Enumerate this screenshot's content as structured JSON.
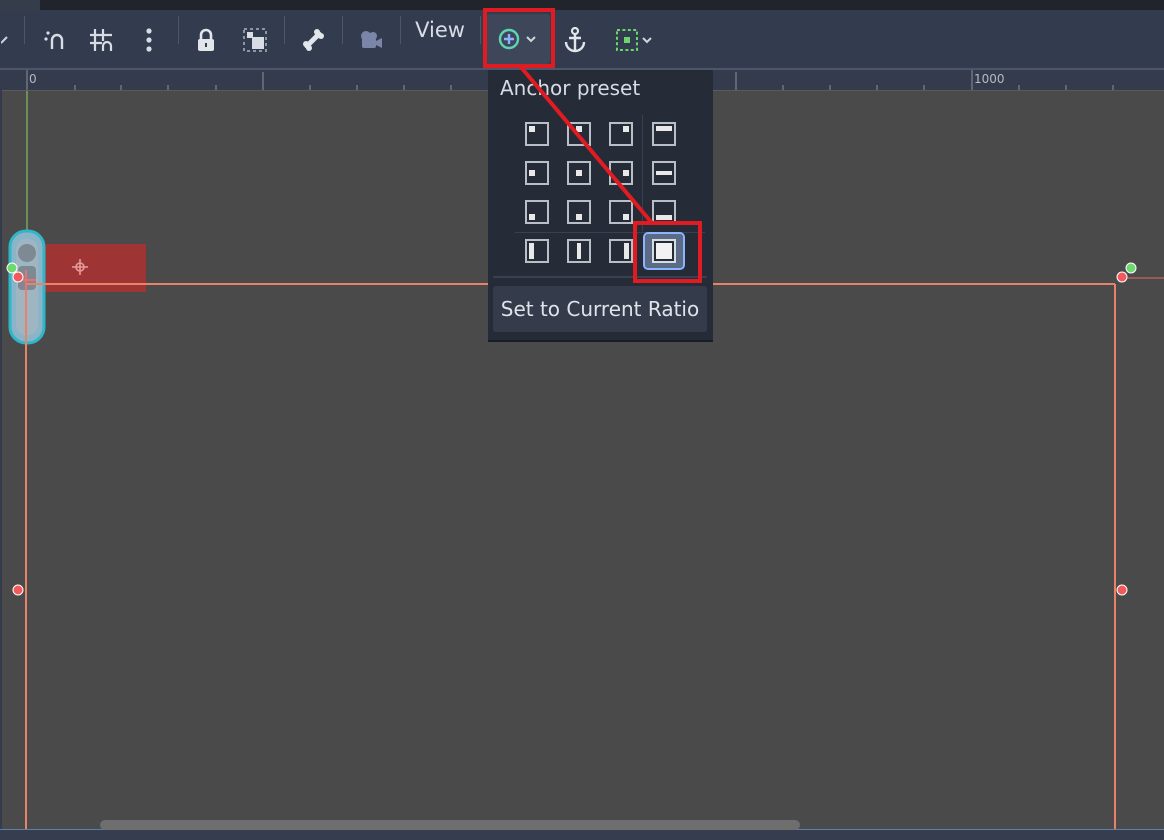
{
  "toolbar": {
    "view_label": "View",
    "buttons": [
      "smart-snap-icon",
      "grid-snap-icon",
      "more-icon",
      "lock-icon",
      "group-icon",
      "bone-icon",
      "camera-override-icon",
      "pivot-icon",
      "anchor-icon",
      "container-layout-icon"
    ]
  },
  "ruler": {
    "label_0": "0",
    "label_1000": "1000"
  },
  "anchor_menu": {
    "title": "Anchor preset",
    "set_ratio_label": "Set to Current Ratio"
  },
  "colors": {
    "highlight": "#e11b22",
    "selection": "#8ab4ff",
    "guide": "#e8836a"
  }
}
